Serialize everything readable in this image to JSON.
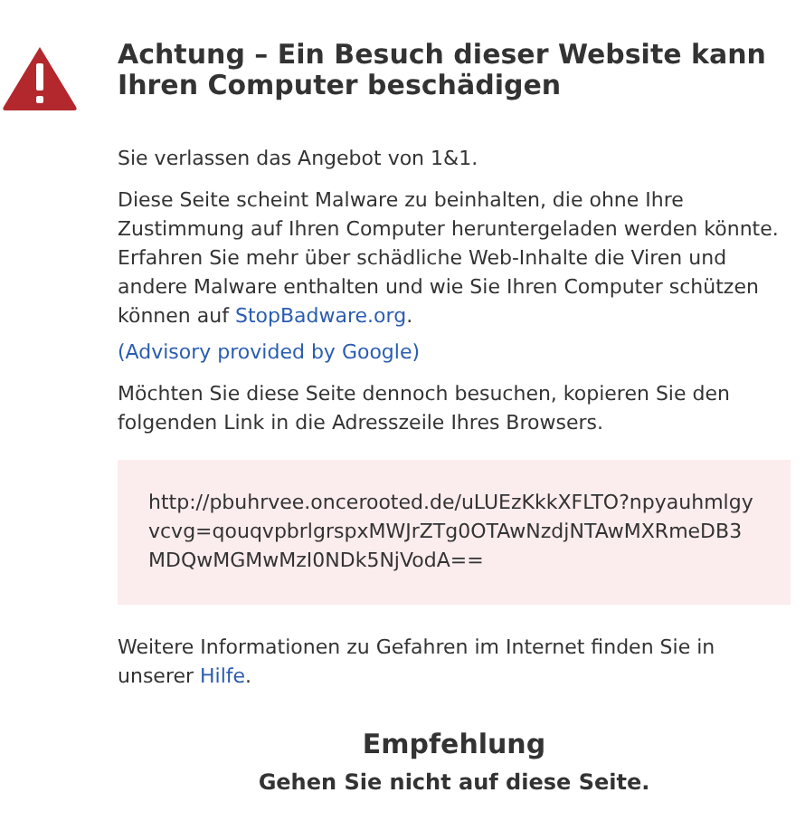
{
  "heading": "Achtung – Ein Besuch dieser Website kann Ihren Computer beschädigen",
  "intro": "Sie verlassen das Angebot von 1&1.",
  "warning": {
    "text": "Diese Seite scheint Malware zu beinhalten, die ohne Ihre Zustimmung auf Ihren Computer heruntergeladen werden könnte. Erfahren Sie mehr über schädliche Web-Inhalte die Viren und andere Malware enthalten und wie Sie Ihren Computer schützen können auf ",
    "link": "StopBadware.org",
    "after": "."
  },
  "advisory_link": "(Advisory provided by Google)",
  "copy_hint": "Möchten Sie diese Seite dennoch besuchen, kopieren Sie den folgenden Link in die Adresszeile Ihres Browsers.",
  "url": "http://pbuhrvee.oncerooted.de/uLUEzKkkXFLTO?npyauhmlgyvcvg=qouqvpbrlgrspxMWJrZTg0OTAwNzdjNTAwMXRmeDB3MDQwMGMwMzI0NDk5NjVodA==",
  "help": {
    "text": "Weitere Informationen zu Gefahren im Internet finden Sie in unserer ",
    "link": "Hilfe",
    "after": "."
  },
  "recommendation": {
    "title": "Empfehlung",
    "text": "Gehen Sie nicht auf diese Seite."
  }
}
